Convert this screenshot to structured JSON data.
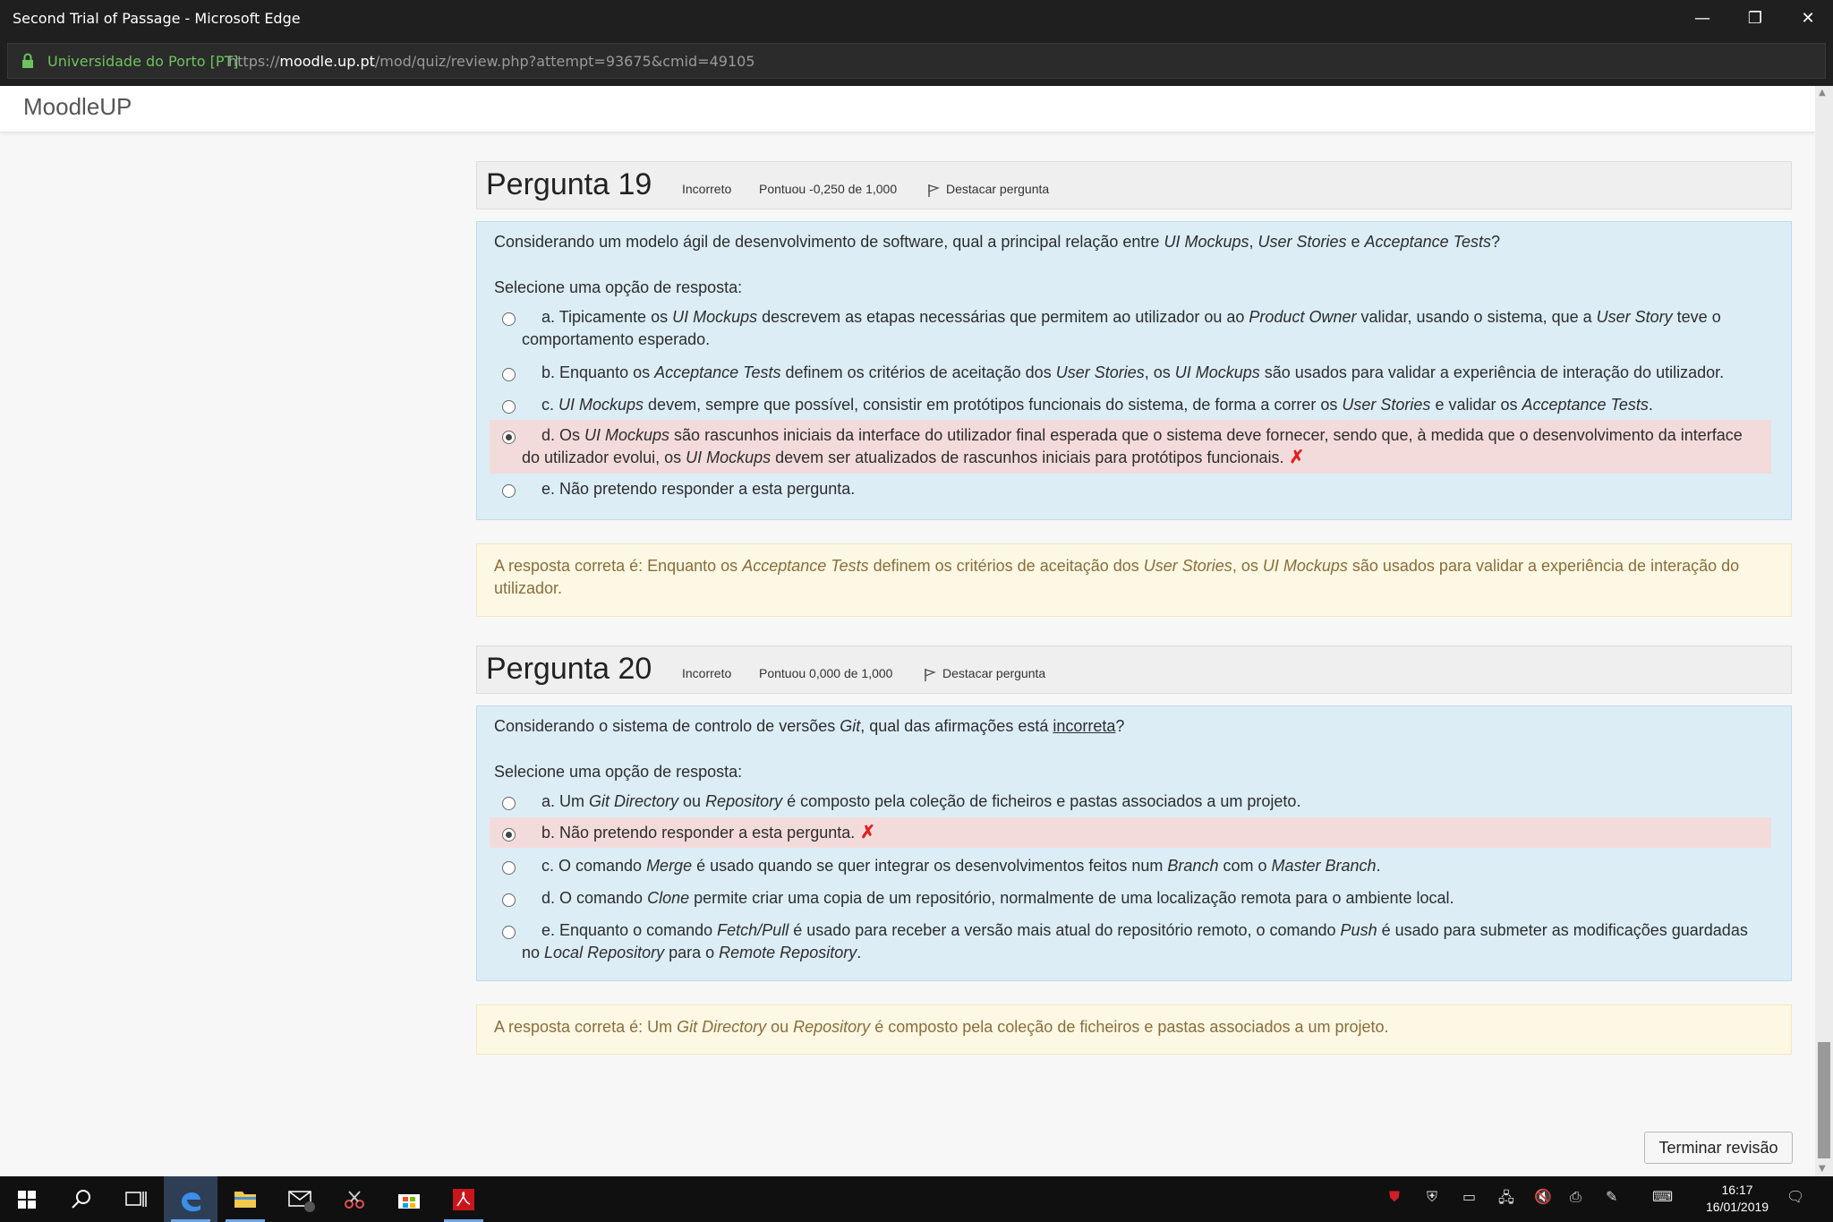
{
  "window": {
    "title": "Second Trial of Passage - Microsoft Edge",
    "minimize": "—",
    "restore": "❐",
    "close": "✕"
  },
  "address": {
    "site_identity": "Universidade do Porto [PT]",
    "url_prefix": "https://",
    "url_host": "moodle.up.pt",
    "url_path": "/mod/quiz/review.php?attempt=93675&cmid=49105"
  },
  "header": {
    "brand": "MoodleUP"
  },
  "q19": {
    "title": "Pergunta 19",
    "state": "Incorreto",
    "grade": "Pontuou -0,250 de 1,000",
    "flag": "Destacar pergunta",
    "prompt": "Selecione uma opção de resposta:",
    "correct_prefix": "A resposta correta é:"
  },
  "q20": {
    "title": "Pergunta 20",
    "state": "Incorreto",
    "grade": "Pontuou 0,000 de 1,000",
    "flag": "Destacar pergunta",
    "prompt": "Selecione uma opção de resposta:",
    "correct_prefix": "A resposta correta é:",
    "answer_b": "b. Não pretendo responder a esta pergunta."
  },
  "q19_answer_e": "e. Não pretendo responder a esta pergunta.",
  "finish_button": "Terminar revisão",
  "clock": {
    "time": "16:17",
    "date": "16/01/2019"
  },
  "colors": {
    "question_bg": "#dcedf6",
    "wrong_answer_bg": "#f4dbdb",
    "feedback_bg": "#fcf8e3",
    "feedback_text": "#8a6d3b",
    "secure_green": "#6dc35e",
    "wrong_mark": "#e02020"
  }
}
